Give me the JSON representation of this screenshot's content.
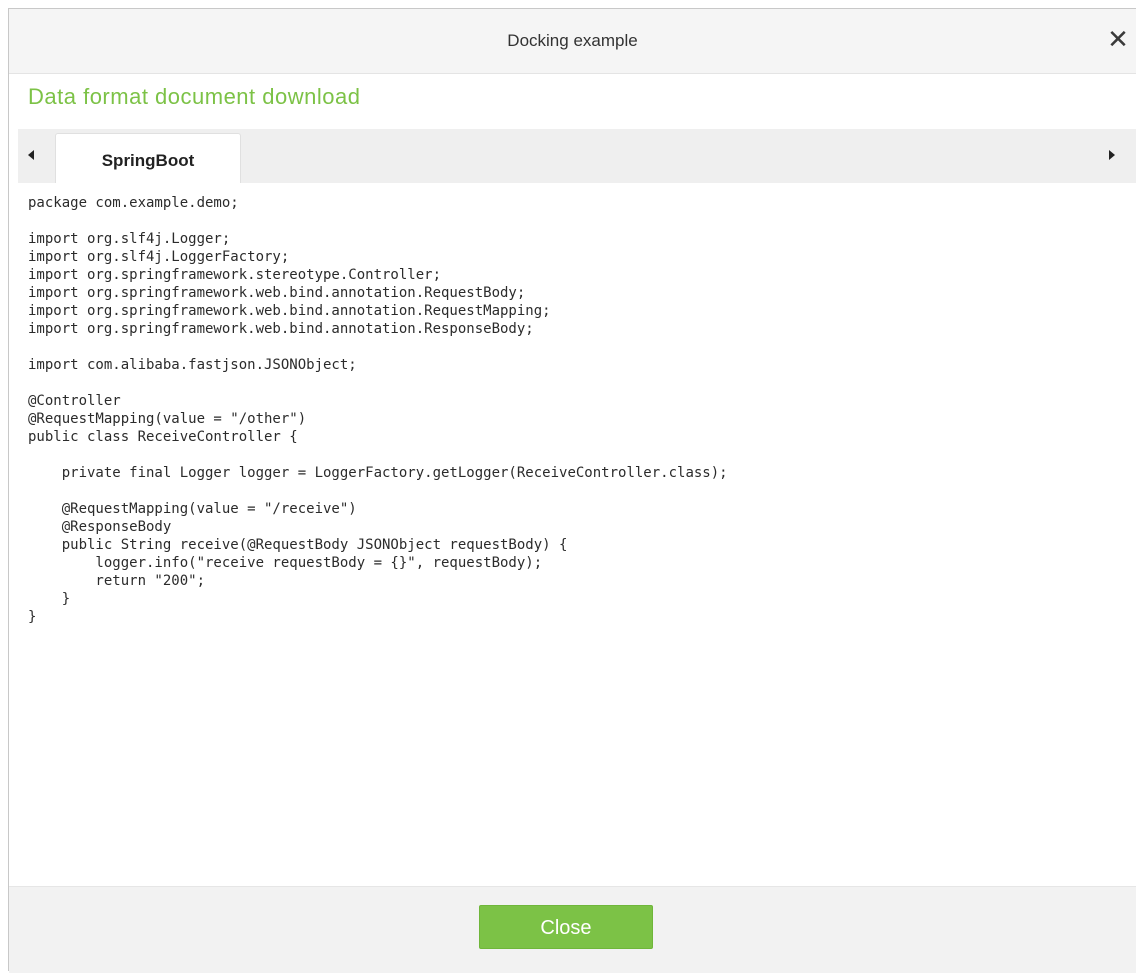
{
  "dialog": {
    "title": "Docking example",
    "close_icon": "close-icon"
  },
  "download_link": "Data format document download",
  "tabs": {
    "prev_icon": "caret-left-icon",
    "next_icon": "caret-right-icon",
    "items": [
      {
        "label": "SpringBoot",
        "active": true
      }
    ]
  },
  "code": {
    "lines": [
      "package com.example.demo;",
      "",
      "import org.slf4j.Logger;",
      "import org.slf4j.LoggerFactory;",
      "import org.springframework.stereotype.Controller;",
      "import org.springframework.web.bind.annotation.RequestBody;",
      "import org.springframework.web.bind.annotation.RequestMapping;",
      "import org.springframework.web.bind.annotation.ResponseBody;",
      "",
      "import com.alibaba.fastjson.JSONObject;",
      "",
      "@Controller",
      "@RequestMapping(value = \"/other\")",
      "public class ReceiveController {",
      "",
      "    private final Logger logger = LoggerFactory.getLogger(ReceiveController.class);",
      "",
      "    @RequestMapping(value = \"/receive\")",
      "    @ResponseBody",
      "    public String receive(@RequestBody JSONObject requestBody) {",
      "        logger.info(\"receive requestBody = {}\", requestBody);",
      "        return \"200\";",
      "    }",
      "}"
    ]
  },
  "footer": {
    "close_label": "Close"
  },
  "colors": {
    "accent_green": "#7cc246",
    "header_bg": "#f5f5f5",
    "tabstrip_bg": "#efefef",
    "footer_bg": "#f2f2f2"
  }
}
